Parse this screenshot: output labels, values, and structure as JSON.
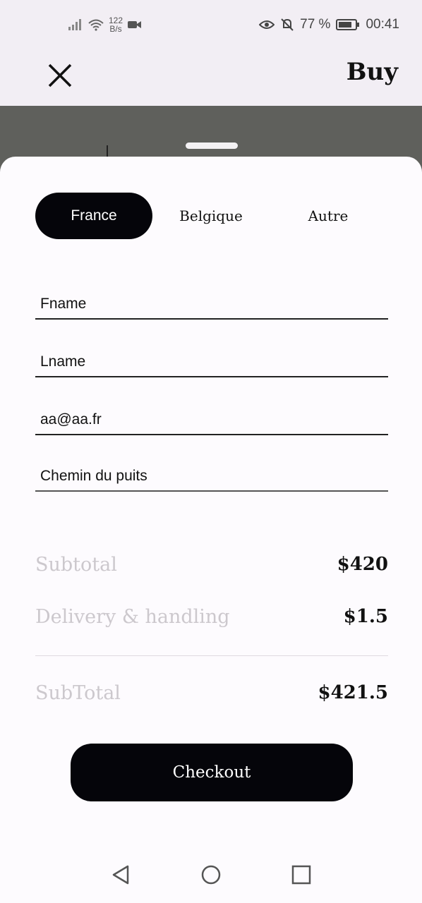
{
  "status_bar": {
    "net_speed_value": "122",
    "net_speed_unit": "B/s",
    "battery": "77 %",
    "time": "00:41"
  },
  "app_bar": {
    "title": "Buy",
    "close_icon": "close-icon"
  },
  "country_tabs": [
    {
      "label": "France",
      "active": true
    },
    {
      "label": "Belgique",
      "active": false
    },
    {
      "label": "Autre",
      "active": false
    }
  ],
  "form": {
    "first_name": "Fname",
    "last_name": "Lname",
    "email": "aa@aa.fr",
    "address": "Chemin du puits"
  },
  "summary": {
    "subtotal_label": "Subtotal",
    "subtotal_value": "$420",
    "delivery_label": "Delivery & handling",
    "delivery_value": "$1.5",
    "total_label": "SubTotal",
    "total_value": "$421.5"
  },
  "checkout_label": "Checkout",
  "colors": {
    "primary": "#05050a",
    "sheet_bg": "#fdfbfe",
    "muted_label": "#ccc8cd"
  }
}
